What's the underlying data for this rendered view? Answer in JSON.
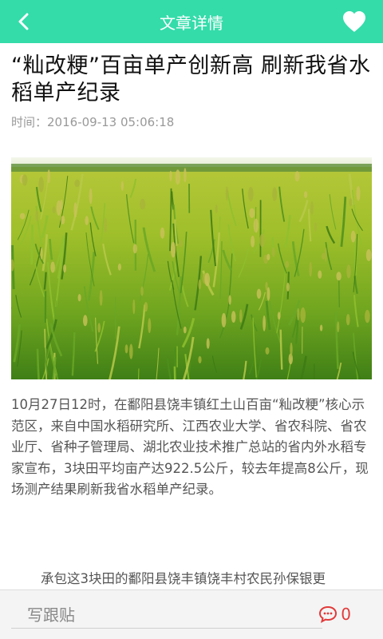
{
  "header": {
    "title": "文章详情"
  },
  "article": {
    "title": "“籼改粳”百亩单产创新高 刷新我省水稻单产纪录",
    "time_label": "时间：",
    "time_value": "2016-09-13 05:06:18",
    "paragraph1": "10月27日12时，在鄱阳县饶丰镇红土山百亩“籼改粳”核心示范区，来自中国水稻研究所、江西农业大学、省农科院、省农业厅、省种子管理局、湖北农业技术推广总站的省内外水稻专家宣布，3块田平均亩产达922.5公斤，较去年提高8公斤，现场测产结果刷新我省水稻单产纪录。",
    "paragraph2": "承包这3块田的鄱阳县饶丰镇饶丰村农民孙保银更"
  },
  "bottom": {
    "reply_placeholder": "写跟贴",
    "comment_count": "0"
  },
  "colors": {
    "header_bg": "#34dcaa",
    "comment_red": "#e23a3a"
  },
  "icons": {
    "back": "chevron-left-icon",
    "favorite": "heart-icon",
    "comment": "comment-bubble-icon"
  }
}
